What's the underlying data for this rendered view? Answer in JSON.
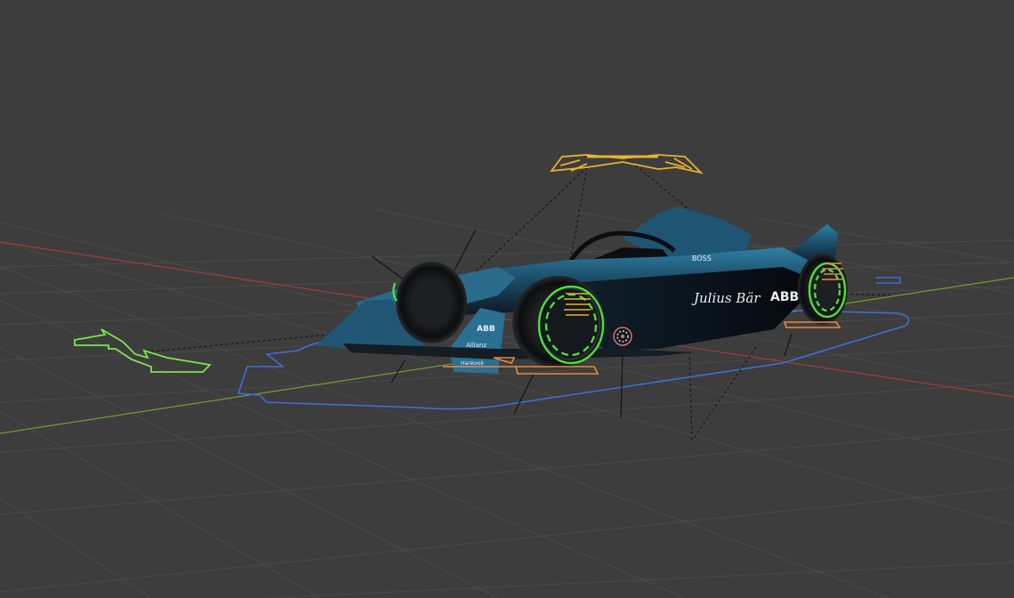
{
  "scene": {
    "colors": {
      "background": "#3d3d3d",
      "grid": "#4a4a4a",
      "x_axis": "#a33a3a",
      "y_axis": "#6e9e2e",
      "body_control": "#3d6fd6",
      "wing_control": "#e8b032",
      "wheel_control": "#4fdc3c",
      "suspension_control": "#e98a3e",
      "move_arrow": "#7ee34c",
      "car_livery": "#2a6a8a"
    },
    "icons": {
      "move_arrow": "double-arrow-icon",
      "origin": "origin-target-icon"
    }
  },
  "car": {
    "sponsor_side": "Julius Bär",
    "sponsor_abb": "ABB",
    "sponsor_boss": "BOSS",
    "sponsor_allianz": "Allianz",
    "sponsor_hankook": "Hankook"
  }
}
